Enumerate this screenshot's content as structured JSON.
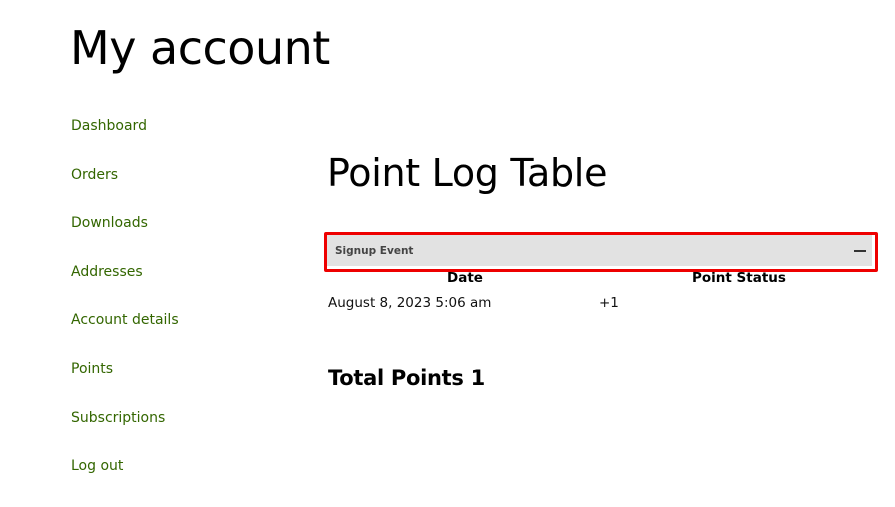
{
  "page": {
    "title": "My account"
  },
  "nav": {
    "items": [
      {
        "label": "Dashboard"
      },
      {
        "label": "Orders"
      },
      {
        "label": "Downloads"
      },
      {
        "label": "Addresses"
      },
      {
        "label": "Account details"
      },
      {
        "label": "Points"
      },
      {
        "label": "Subscriptions"
      },
      {
        "label": "Log out"
      }
    ]
  },
  "main": {
    "title": "Point Log Table",
    "accordion": {
      "label": "Signup Event",
      "toggle_icon": "minus-icon"
    },
    "table": {
      "headers": [
        "Date",
        "Point Status"
      ],
      "rows": [
        {
          "date": "August 8, 2023 5:06 am",
          "points": "+1"
        }
      ]
    },
    "total": {
      "label": "Total Points",
      "value": "1"
    }
  },
  "colors": {
    "link": "#336600",
    "highlight_border": "#ee0000",
    "accordion_bg": "#e2e2e2"
  }
}
